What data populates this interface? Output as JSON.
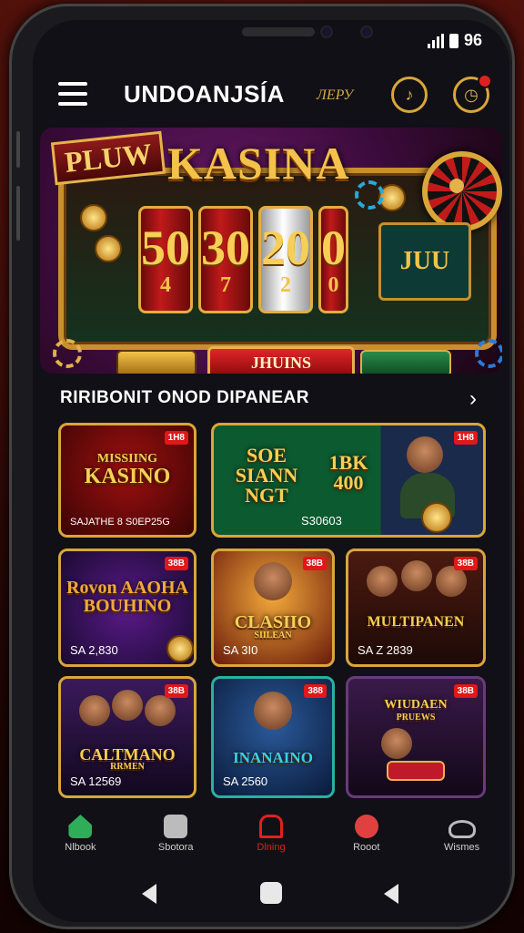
{
  "status_bar": {
    "time": "96"
  },
  "header": {
    "title": "UNDOANJSÍA",
    "tagline": "ЛЕРУ"
  },
  "banner": {
    "badge": "PLUW",
    "title": "KASINA",
    "reels": [
      {
        "big": "50",
        "small": "4"
      },
      {
        "big": "30",
        "small": "7"
      },
      {
        "big": "20",
        "small": "2"
      },
      {
        "big": "0",
        "small": "0"
      }
    ],
    "side_screen": "JUU",
    "button": "JHUINS"
  },
  "section": {
    "title": "RIRIBONIT ONOD DIPANEAR",
    "arrow": "›"
  },
  "games": [
    {
      "name": "KASINO",
      "subtitle": "MISSIING",
      "price": "SAJATHE 8 S0EP25G",
      "tag": "1H8"
    },
    {
      "name": "SOE SIANN NGT",
      "right_name": "1BK 400",
      "price": "S30603",
      "tag": "1H8"
    },
    {
      "name": "Rovon AAOHA BOUHINO",
      "price": "SA 2,830",
      "tag": "38B"
    },
    {
      "name": "CLASIIO",
      "subtitle": "SIILEAN",
      "price": "SA 3I0",
      "tag": "38B"
    },
    {
      "name": "MULTIPANEN",
      "price": "SA Z 2839",
      "tag": "38B"
    },
    {
      "name": "CALTMANO",
      "subtitle": "RRMEN",
      "price": "SA 12569",
      "tag": "38B"
    },
    {
      "name": "INANAINO",
      "price": "SA 2560",
      "tag": "388"
    },
    {
      "name": "WIUDAEN",
      "subtitle": "PRUEWS",
      "price": "",
      "tag": "38B"
    }
  ],
  "bottom_nav": [
    {
      "label": "Nlbook",
      "icon": "home-icon",
      "color": "#2fae5a"
    },
    {
      "label": "Sbotora",
      "icon": "bag-icon",
      "color": "#bbbbbb"
    },
    {
      "label": "Dlning",
      "icon": "door-icon",
      "color": "#e02020"
    },
    {
      "label": "Rooot",
      "icon": "chat-icon",
      "color": "#e04040"
    },
    {
      "label": "Wismes",
      "icon": "hat-icon",
      "color": "#bbbbbb"
    }
  ],
  "colors": {
    "gold": "#d9a63a",
    "red": "#e02020",
    "bg": "#101016"
  }
}
